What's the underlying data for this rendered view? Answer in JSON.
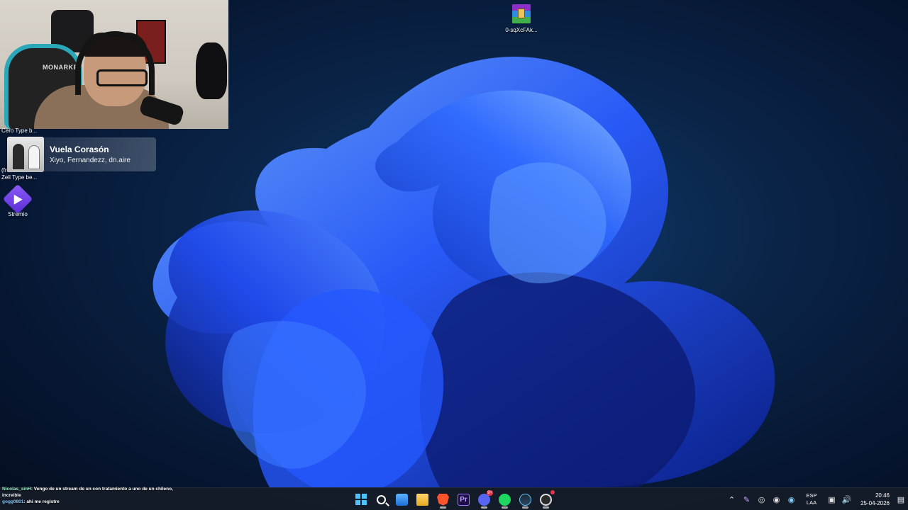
{
  "desktop": {
    "icons": [
      {
        "label": "0-sqXcFAk..."
      },
      {
        "label": "Stremio"
      }
    ],
    "partial_labels": {
      "cero": "Cero Type b...",
      "fre": "(fre",
      "zell": "Zell Type be..."
    }
  },
  "webcam": {
    "chair_logo": "MONARKEY"
  },
  "now_playing": {
    "title": "Vuela Corasón",
    "artist": "Xiyo, Fernandezz, dn.aire"
  },
  "chat": [
    {
      "user": "Nicolas_sinH",
      "message": ": Vengo de un stream de un  con tratamiento a uno de un chileno, increible"
    },
    {
      "user": "gogg0801",
      "message": ": ahi me registre"
    }
  ],
  "taskbar": {
    "apps": [
      {
        "name": "start",
        "icon": "windows-logo-icon"
      },
      {
        "name": "search",
        "icon": "search-icon"
      },
      {
        "name": "photos",
        "icon": "photos-icon"
      },
      {
        "name": "file-explorer",
        "icon": "folder-icon"
      },
      {
        "name": "brave",
        "icon": "brave-lion-icon"
      },
      {
        "name": "premiere-pro",
        "icon": "premiere-pro-icon",
        "text": "Pr"
      },
      {
        "name": "discord",
        "icon": "discord-icon",
        "badge": "9+"
      },
      {
        "name": "spotify",
        "icon": "spotify-icon"
      },
      {
        "name": "steam",
        "icon": "steam-icon"
      },
      {
        "name": "obs",
        "icon": "obs-icon"
      }
    ],
    "tray": {
      "language_top": "ESP",
      "language_bottom": "LAA",
      "time": "20:46",
      "date": "25-04-2026"
    }
  },
  "colors": {
    "accent": "#4cc2ff",
    "wallpaper_bloom": "#1f5bff",
    "taskbar_bg": "#161c28"
  }
}
